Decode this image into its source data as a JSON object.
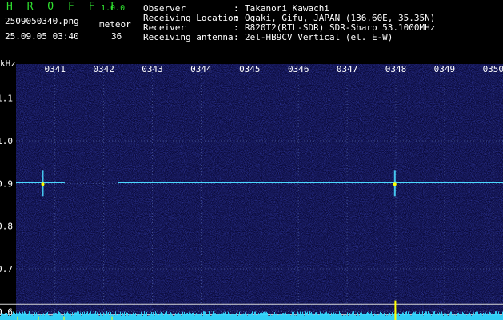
{
  "header": {
    "logo": "H R O F F T",
    "version": "1.0.0",
    "filename": "2509050340.png",
    "timestamp": "25.09.05 03:40",
    "meteor_label": "meteor",
    "meteor_count": "36"
  },
  "meta": [
    {
      "key": "Observer",
      "value": "Takanori Kawachi"
    },
    {
      "key": "Receiving Location",
      "value": "Ogaki, Gifu, JAPAN (136.60E, 35.35N)"
    },
    {
      "key": "Receiver",
      "value": "R820T2(RTL-SDR) SDR-Sharp 53.1000MHz"
    },
    {
      "key": "Receiving antenna",
      "value": "2el-HB9CV Vertical (el. E-W)"
    }
  ],
  "colors": {
    "background": "#000000",
    "plot_bg": "#0a0a3a",
    "carrier": "#4ad8ff",
    "spectrum": "#33d8ff",
    "spike": "#ffff00",
    "text": "#ffffff",
    "logo": "#2fe02f"
  },
  "chart_data": {
    "type": "heatmap",
    "ylabel": "kHz",
    "ylim": [
      0.58,
      1.18
    ],
    "yticks": [
      "1.1",
      "1.0",
      "0.9",
      "0.8",
      "0.7",
      "0.6"
    ],
    "x_ticks": [
      "0341",
      "0342",
      "0343",
      "0344",
      "0345",
      "0346",
      "0347",
      "0348",
      "0349",
      "0350"
    ],
    "xlim": [
      340.2,
      350.2
    ],
    "carrier": {
      "freq": 0.902,
      "segments": [
        [
          340.2,
          341.2
        ],
        [
          342.3,
          350.2
        ]
      ]
    },
    "meteors": [
      {
        "time": 340.75,
        "f1": 0.87,
        "f2": 0.93
      },
      {
        "time": 347.98,
        "f1": 0.87,
        "f2": 0.93
      }
    ],
    "reference_lines": [
      0.617,
      0.592
    ],
    "spike_time": 347.99,
    "grid": true
  }
}
